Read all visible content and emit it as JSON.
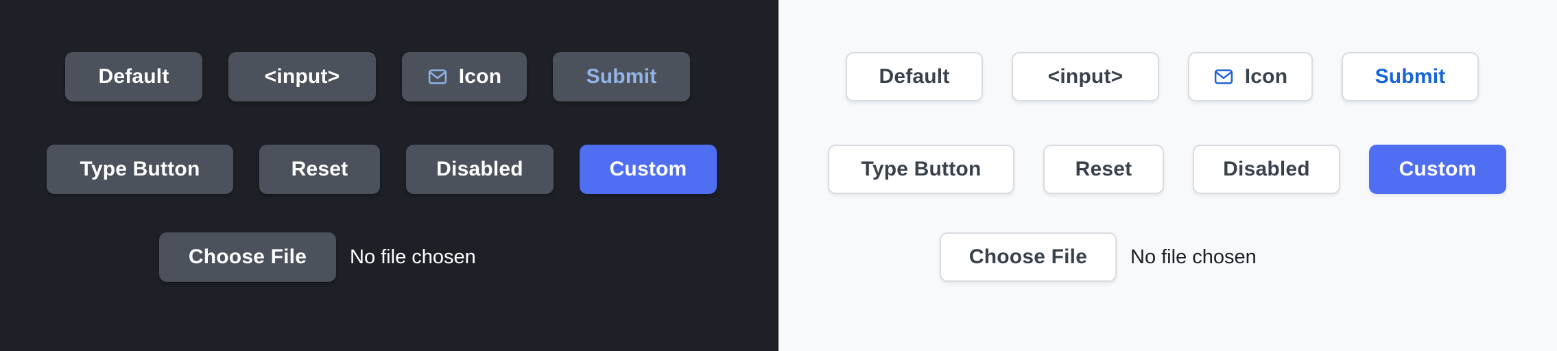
{
  "panels": [
    {
      "theme": "dark",
      "background": "#1d2127",
      "button_bg": "#4b525b",
      "text_color": "#ffffff",
      "accent_color": "#93b4e6",
      "filled_color": "#4f6ef2",
      "rows": [
        {
          "buttons": [
            {
              "label": "Default",
              "variant": "default",
              "icon": null
            },
            {
              "label": "<input>",
              "variant": "default",
              "icon": null
            },
            {
              "label": "Icon",
              "variant": "default",
              "icon": "mail-icon"
            },
            {
              "label": "Submit",
              "variant": "accent-text",
              "icon": null
            }
          ]
        },
        {
          "buttons": [
            {
              "label": "Type Button",
              "variant": "default",
              "icon": null
            },
            {
              "label": "Reset",
              "variant": "default",
              "icon": null
            },
            {
              "label": "Disabled",
              "variant": "default",
              "icon": null
            },
            {
              "label": "Custom",
              "variant": "filled",
              "icon": null
            }
          ]
        }
      ],
      "file_input": {
        "button_label": "Choose File",
        "status_text": "No file chosen"
      }
    },
    {
      "theme": "light",
      "background": "#f7f9fb",
      "button_bg": "#ffffff",
      "border_color": "#d8dbe0",
      "text_color": "#39414c",
      "accent_color": "#1464d8",
      "filled_color": "#4f6ef2",
      "rows": [
        {
          "buttons": [
            {
              "label": "Default",
              "variant": "default",
              "icon": null
            },
            {
              "label": "<input>",
              "variant": "default",
              "icon": null
            },
            {
              "label": "Icon",
              "variant": "default",
              "icon": "mail-icon"
            },
            {
              "label": "Submit",
              "variant": "accent-text",
              "icon": null
            }
          ]
        },
        {
          "buttons": [
            {
              "label": "Type Button",
              "variant": "default",
              "icon": null
            },
            {
              "label": "Reset",
              "variant": "default",
              "icon": null
            },
            {
              "label": "Disabled",
              "variant": "default",
              "icon": null
            },
            {
              "label": "Custom",
              "variant": "filled",
              "icon": null
            }
          ]
        }
      ],
      "file_input": {
        "button_label": "Choose File",
        "status_text": "No file chosen"
      }
    }
  ]
}
